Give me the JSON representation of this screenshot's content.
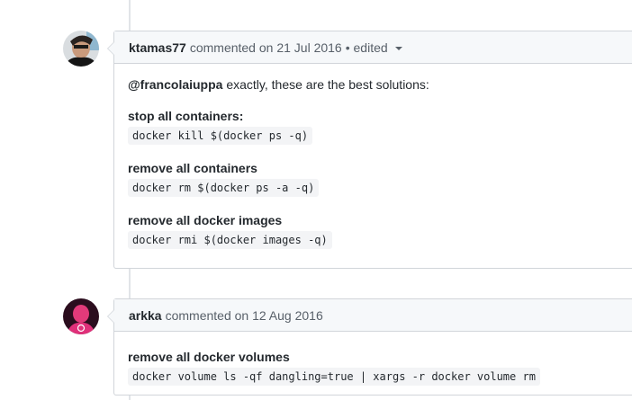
{
  "comments": [
    {
      "author": "ktamas77",
      "action_date": "commented on 21 Jul 2016",
      "edited": "• edited",
      "mention": "@francolaiuppa",
      "intro_text": " exactly, these are the best solutions:",
      "sections": [
        {
          "title": "stop all containers:",
          "code": "docker kill $(docker ps -q)"
        },
        {
          "title": "remove all containers",
          "code": "docker rm $(docker ps -a -q)"
        },
        {
          "title": "remove all docker images",
          "code": "docker rmi $(docker images -q)"
        }
      ]
    },
    {
      "author": "arkka",
      "action_date": "commented on 12 Aug 2016",
      "sections": [
        {
          "title": "remove all docker volumes",
          "code": "docker volume ls -qf dangling=true | xargs -r docker volume rm"
        }
      ]
    }
  ],
  "colors": {
    "header_bg": "#f6f8fa",
    "border": "#d1d5da",
    "code_bg": "#f3f4f6",
    "text": "#24292e",
    "muted": "#586069"
  }
}
